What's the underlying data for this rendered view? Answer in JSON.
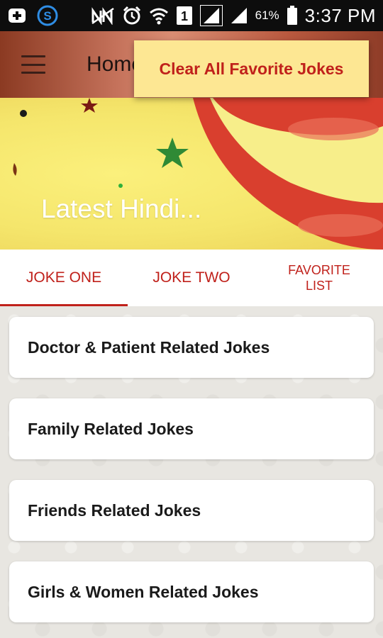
{
  "status_bar": {
    "battery_percent": "61%",
    "time": "3:37 PM",
    "sim_slot": "1",
    "icons": [
      "add-box-icon",
      "s-app-icon",
      "no-signal-icon",
      "alarm-icon",
      "wifi-icon",
      "sim-slot-icon",
      "signal-icon",
      "signal-icon",
      "battery-icon"
    ]
  },
  "toolbar": {
    "title": "Home",
    "menu_icon": "hamburger-menu-icon"
  },
  "popup_menu": {
    "items": [
      {
        "label": "Clear All Favorite Jokes"
      }
    ]
  },
  "banner": {
    "title": "Latest Hindi..."
  },
  "tabs": [
    {
      "label": "JOKE ONE",
      "active": true
    },
    {
      "label": "JOKE TWO",
      "active": false
    },
    {
      "label": "FAVORITE LIST",
      "active": false
    }
  ],
  "categories": [
    {
      "label": "Doctor & Patient Related Jokes"
    },
    {
      "label": "Family Related Jokes"
    },
    {
      "label": "Friends Related Jokes"
    },
    {
      "label": "Girls & Women Related Jokes"
    }
  ],
  "colors": {
    "accent": "#c0211b",
    "popup_bg": "#fde793",
    "status_bar_bg": "#0d0d0d",
    "banner_yellow": "#f5e66c"
  }
}
